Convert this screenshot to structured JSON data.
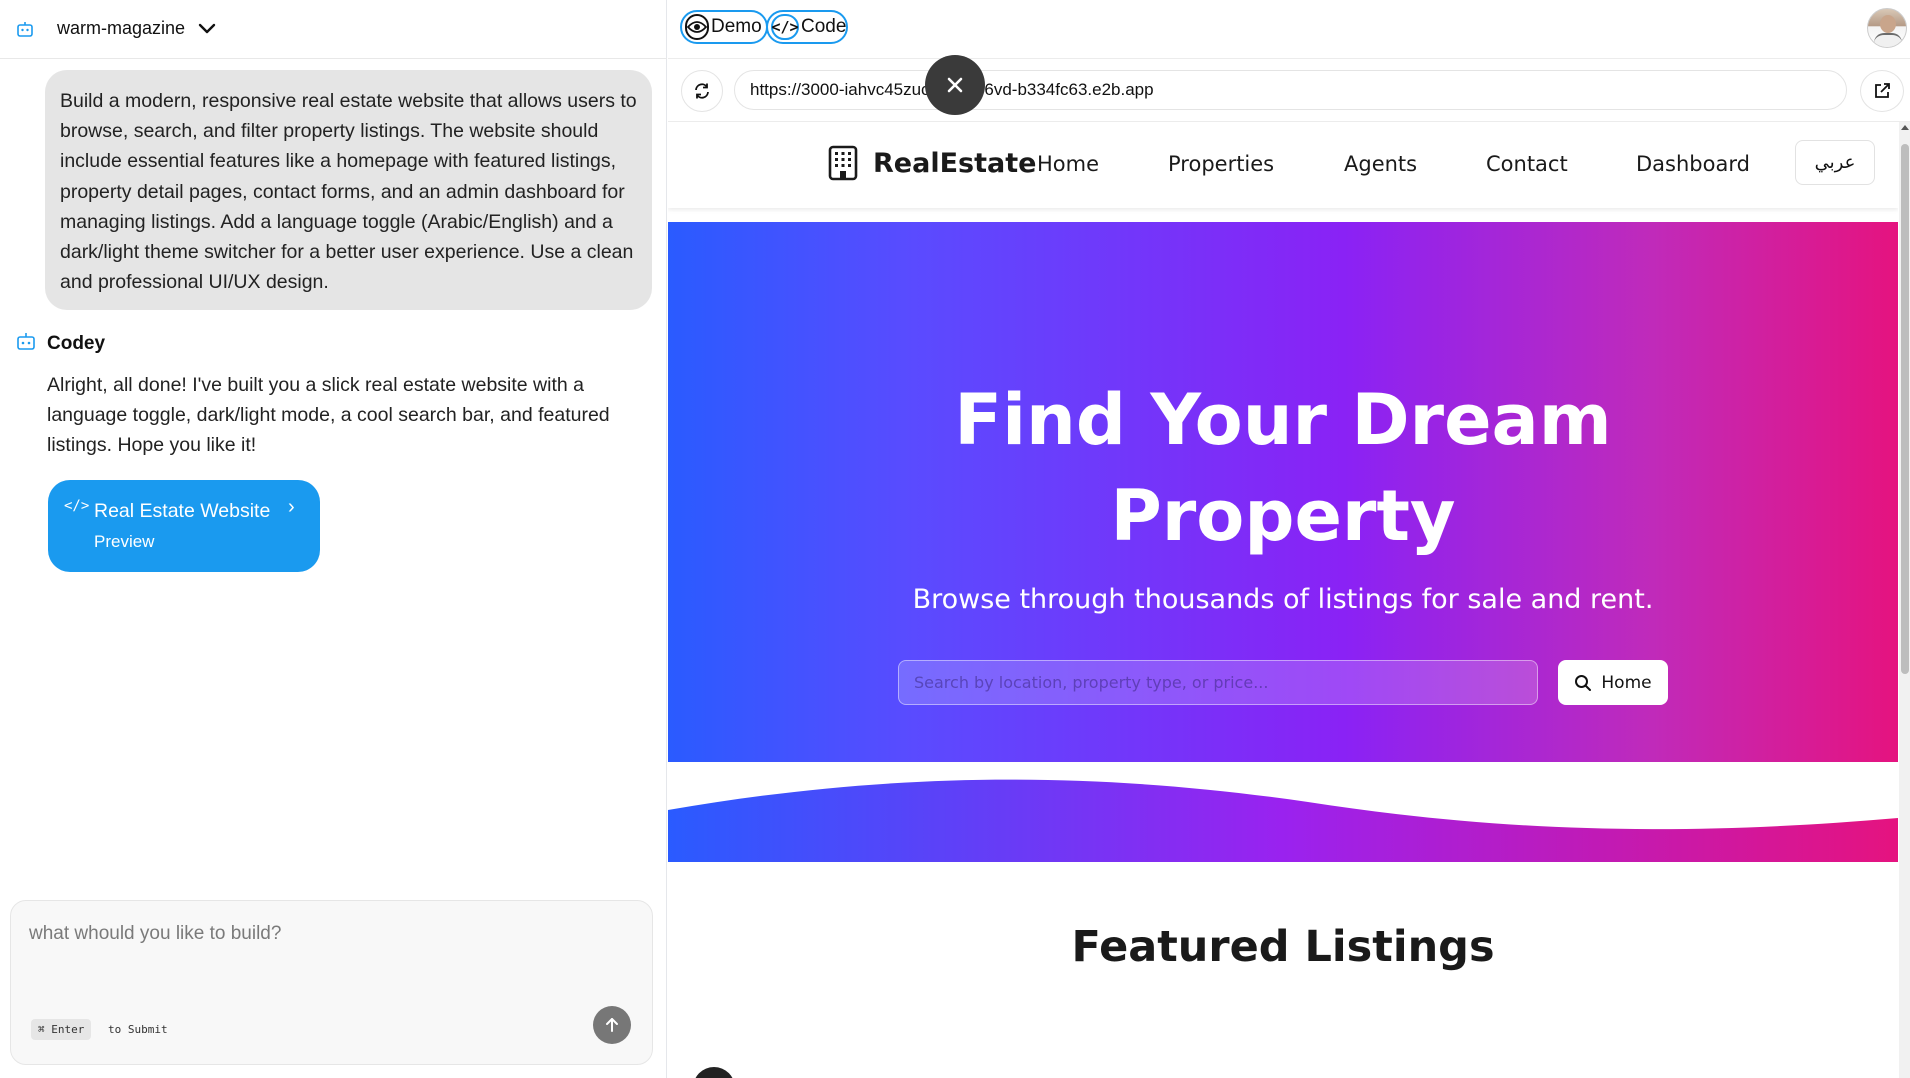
{
  "left": {
    "project_name": "warm-magazine",
    "user_prompt": "Build a modern, responsive real estate website that allows users to browse, search, and filter property listings. The website should include essential features like a homepage with featured listings, property detail pages, contact forms, and an admin dashboard for managing listings. Add a language toggle (Arabic/English) and a dark/light theme switcher for a better user experience. Use a clean and professional UI/UX design.",
    "assistant_name": "Codey",
    "assistant_message": "Alright, all done! I've built you a slick real estate website with a language toggle, dark/light mode, a cool search bar, and featured listings. Hope you like it!",
    "preview_card": {
      "title": "Real Estate Website",
      "subtitle": "Preview"
    },
    "composer": {
      "placeholder": "what whould you like to build?",
      "shortcut_key": "⌘ Enter",
      "shortcut_label": "to Submit"
    }
  },
  "right": {
    "tabs": [
      {
        "label": "Demo",
        "icon": "eye-icon"
      },
      {
        "label": "Code",
        "icon": "code-icon"
      }
    ],
    "url": "https://3000-iahvc45zucjtkg2d06vd-b334fc63.e2b.app",
    "site": {
      "brand": "RealEstate",
      "nav": [
        "Home",
        "Properties",
        "Agents",
        "Contact",
        "Dashboard"
      ],
      "lang_toggle": "عربي",
      "hero_title_line1": "Find Your Dream",
      "hero_title_line2": "Property",
      "hero_subtitle": "Browse through thousands of listings for sale and rent.",
      "search_placeholder": "Search by location, property type, or price...",
      "search_button": "Home",
      "featured_heading": "Featured Listings"
    }
  },
  "colors": {
    "accent": "#1a9aef",
    "hero_gradient_start": "#2a5bff",
    "hero_gradient_mid": "#8a22f5",
    "hero_gradient_end": "#e5137f"
  }
}
